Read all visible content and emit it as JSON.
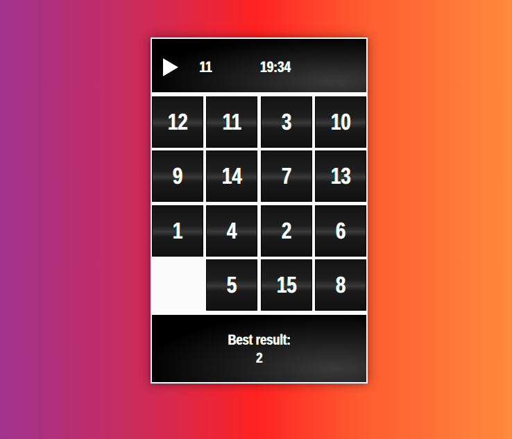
{
  "header": {
    "play_icon": "play-icon",
    "moves": "11",
    "time": "19:34"
  },
  "board": {
    "tiles": [
      "12",
      "11",
      "3",
      "10",
      "9",
      "14",
      "7",
      "13",
      "1",
      "4",
      "2",
      "6",
      "",
      "5",
      "15",
      "8"
    ]
  },
  "footer": {
    "best_label": "Best result:",
    "best_value": "2"
  },
  "colors": {
    "tile": "#1a1a1a",
    "empty": "#fafafa",
    "text": "#ffffff"
  }
}
